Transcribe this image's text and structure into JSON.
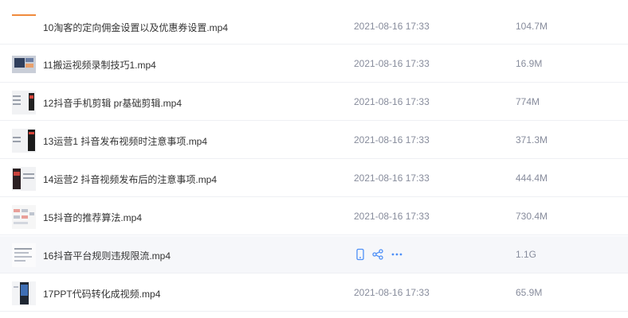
{
  "files": [
    {
      "name": "10淘客的定向佣金设置以及优惠券设置.mp4",
      "date": "2021-08-16 17:33",
      "size": "104.7M",
      "thumb": "orange-bar"
    },
    {
      "name": "11搬运视频录制技巧1.mp4",
      "date": "2021-08-16 17:33",
      "size": "16.9M",
      "thumb": "screen"
    },
    {
      "name": "12抖音手机剪辑 pr基础剪辑.mp4",
      "date": "2021-08-16 17:33",
      "size": "774M",
      "thumb": "phone-doc"
    },
    {
      "name": "13运营1 抖音发布视频时注意事项.mp4",
      "date": "2021-08-16 17:33",
      "size": "371.3M",
      "thumb": "phone-dark"
    },
    {
      "name": "14运营2 抖音视频发布后的注意事项.mp4",
      "date": "2021-08-16 17:33",
      "size": "444.4M",
      "thumb": "phone-red"
    },
    {
      "name": "15抖音的推荐算法.mp4",
      "date": "2021-08-16 17:33",
      "size": "730.4M",
      "thumb": "flowchart"
    },
    {
      "name": "16抖音平台规则违规限流.mp4",
      "date": "",
      "size": "1.1G",
      "thumb": "doc-lines",
      "hovered": true
    },
    {
      "name": "17PPT代码转化成视频.mp4",
      "date": "2021-08-16 17:33",
      "size": "65.9M",
      "thumb": "phone-blue"
    }
  ],
  "actions": {
    "icons": [
      "phone-icon",
      "share-icon",
      "more-icon"
    ]
  },
  "colors": {
    "accent": "#4d8ff7",
    "muted": "#878c9c",
    "hover_bg": "#f6f7fa"
  }
}
